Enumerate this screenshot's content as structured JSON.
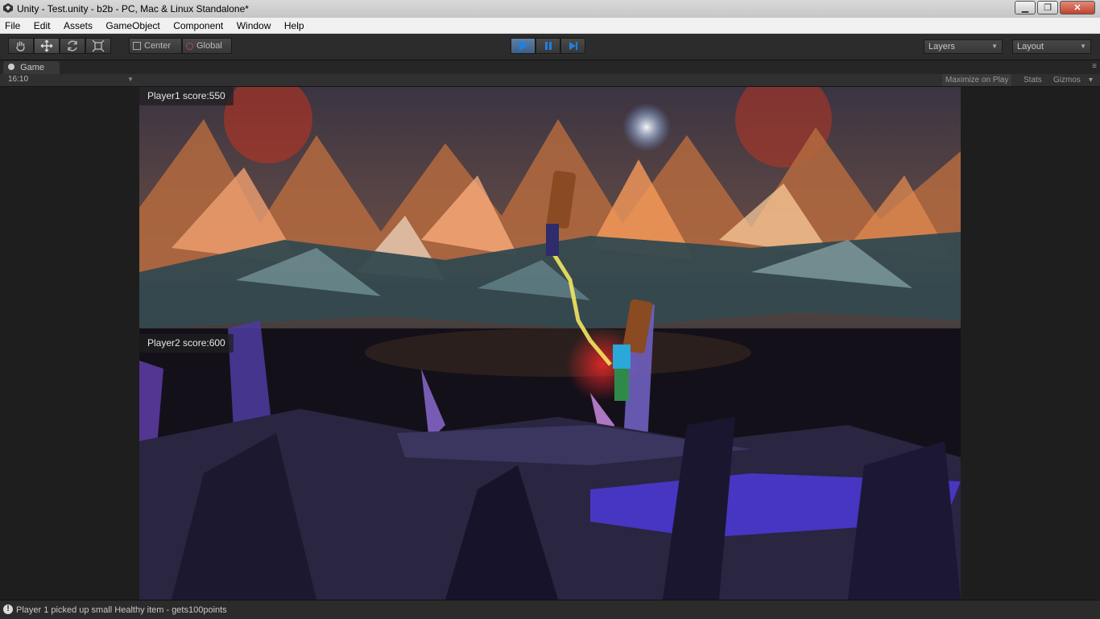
{
  "window": {
    "title": "Unity - Test.unity - b2b - PC, Mac & Linux Standalone*"
  },
  "menu": {
    "items": [
      "File",
      "Edit",
      "Assets",
      "GameObject",
      "Component",
      "Window",
      "Help"
    ]
  },
  "toolbar": {
    "tools": [
      "hand-tool-icon",
      "move-tool-icon",
      "rotate-tool-icon",
      "scale-tool-icon"
    ],
    "pivot_label": "Center",
    "space_label": "Global",
    "layers_label": "Layers",
    "layout_label": "Layout"
  },
  "game_tab": {
    "label": "Game",
    "aspect": "16:10",
    "maximize_label": "Maximize on Play",
    "stats_label": "Stats",
    "gizmos_label": "Gizmos"
  },
  "game": {
    "player1_score": "Player1 score:550",
    "player2_score": "Player2 score:600"
  },
  "status": {
    "message": "Player 1 picked up small Healthy item - gets100points"
  },
  "colors": {
    "play_accent": "#3d5f86",
    "panel_bg": "#1e1e1e"
  }
}
